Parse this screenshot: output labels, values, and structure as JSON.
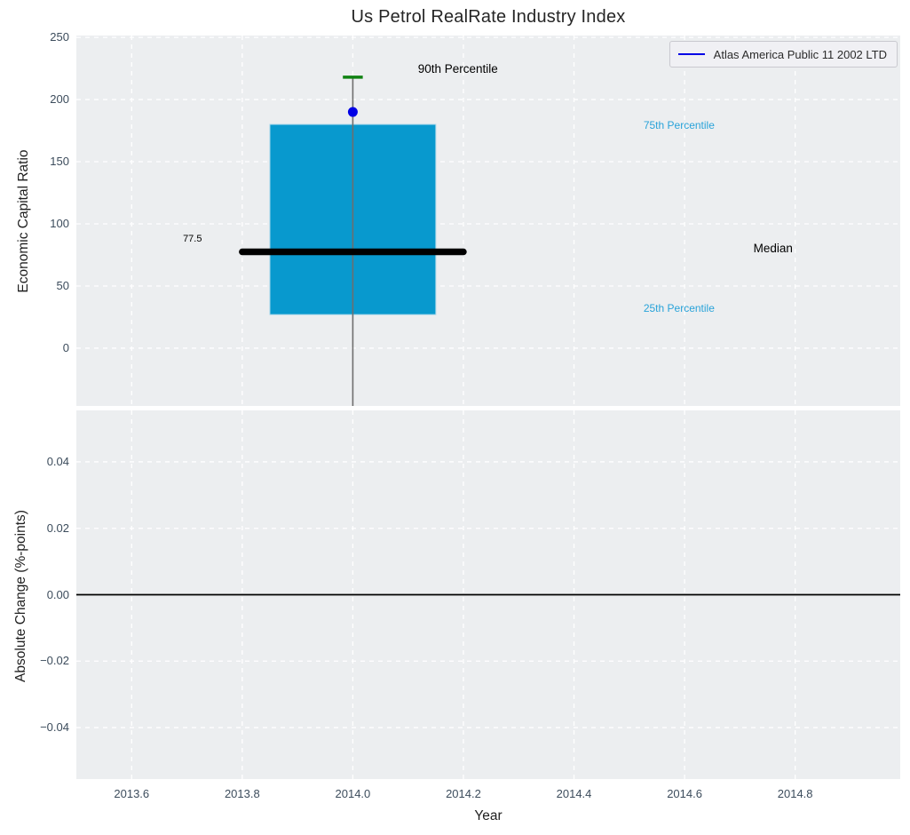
{
  "figure": {
    "title": "Us Petrol RealRate Industry Index",
    "background": "#ffffff",
    "plot_background": "#eceef0",
    "grid_color": "#ffffff",
    "tick_color": "#3c4c5c",
    "legend": {
      "label": "Atlas America Public 11 2002 LTD",
      "line_color": "#0000e6",
      "position": "top-right"
    }
  },
  "chart_data": [
    {
      "type": "boxplot",
      "title": "Us Petrol RealRate Industry Index",
      "xlabel": "",
      "ylabel": "Economic Capital Ratio",
      "xlim": [
        2013.5,
        2014.99
      ],
      "ylim": [
        -46.5,
        251.5
      ],
      "xticks": [
        2013.6,
        2013.8,
        2014.0,
        2014.2,
        2014.4,
        2014.6,
        2014.8
      ],
      "yticks": [
        0,
        50,
        100,
        150,
        200,
        250
      ],
      "grid": true,
      "show_x_tick_labels": false,
      "series": [
        {
          "name": "Atlas America Public 11 2002 LTD",
          "x": 2014.0,
          "box_left": 2013.85,
          "box_right": 2014.15,
          "median": 77.5,
          "median_left": 2013.8,
          "median_right": 2014.2,
          "q1": 27,
          "q3": 180,
          "p90": 218,
          "p90_cap_left": 2013.982,
          "p90_cap_right": 2014.018,
          "whisker_bottom_clipped": true,
          "point_value": 190,
          "box_color": "#0899ce",
          "box_edge_color": "#a5d6ea",
          "median_color": "#000000",
          "cap_color": "#108212",
          "point_color": "#0000e6",
          "whisker_color": "#6e6e6e"
        }
      ],
      "annotations": [
        {
          "id": "p90-label",
          "text": "90th Percentile",
          "x": 2014.19,
          "y": 224,
          "color": "#000000",
          "size": 13.5
        },
        {
          "id": "median-value",
          "text": "77.5",
          "x": 2013.71,
          "y": 87,
          "color": "#000000",
          "size": 11
        },
        {
          "id": "p75-label",
          "text": "75th Percentile",
          "x": 2014.59,
          "y": 179,
          "color": "#29a3d9",
          "size": 12
        },
        {
          "id": "median-label",
          "text": "Median",
          "x": 2014.76,
          "y": 80,
          "color": "#000000",
          "size": 13.5
        },
        {
          "id": "p25-label",
          "text": "25th Percentile",
          "x": 2014.59,
          "y": 32,
          "color": "#29a3d9",
          "size": 12
        }
      ]
    },
    {
      "type": "line",
      "title": "",
      "xlabel": "Year",
      "ylabel": "Absolute Change (%-points)",
      "xlim": [
        2013.5,
        2014.99
      ],
      "ylim": [
        -0.0555,
        0.0555
      ],
      "xticks": [
        2013.6,
        2013.8,
        2014.0,
        2014.2,
        2014.4,
        2014.6,
        2014.8
      ],
      "yticks": [
        -0.04,
        -0.02,
        0.0,
        0.02,
        0.04
      ],
      "grid": true,
      "show_x_tick_labels": true,
      "zero_line": {
        "y": 0.0,
        "color": "#000000"
      },
      "series": []
    }
  ]
}
